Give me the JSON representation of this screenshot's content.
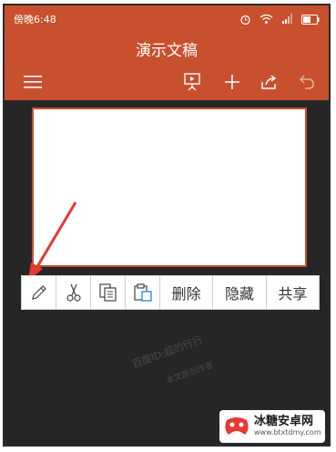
{
  "status_bar": {
    "time": "傍晚6:48"
  },
  "title_bar": {
    "title": "演示文稿"
  },
  "toolbar": {
    "menu_icon": "hamburger-icon",
    "present_icon": "present-icon",
    "add_icon": "plus-icon",
    "share_icon": "share-icon",
    "undo_icon": "undo-icon"
  },
  "context_menu": {
    "edit_icon": "pencil-icon",
    "cut_icon": "scissors-icon",
    "copy_icon": "copy-icon",
    "paste_icon": "paste-icon",
    "delete_label": "删除",
    "hide_label": "隐藏",
    "share_label": "共享"
  },
  "watermark": {
    "line1": "百度ID:超的行行",
    "line2": "本文原创作者"
  },
  "logo": {
    "name": "冰糖安卓网",
    "url": "www.btxtdmy.com"
  },
  "colors": {
    "accent": "#c8502e",
    "background": "#262626",
    "arrow": "#e53935"
  }
}
